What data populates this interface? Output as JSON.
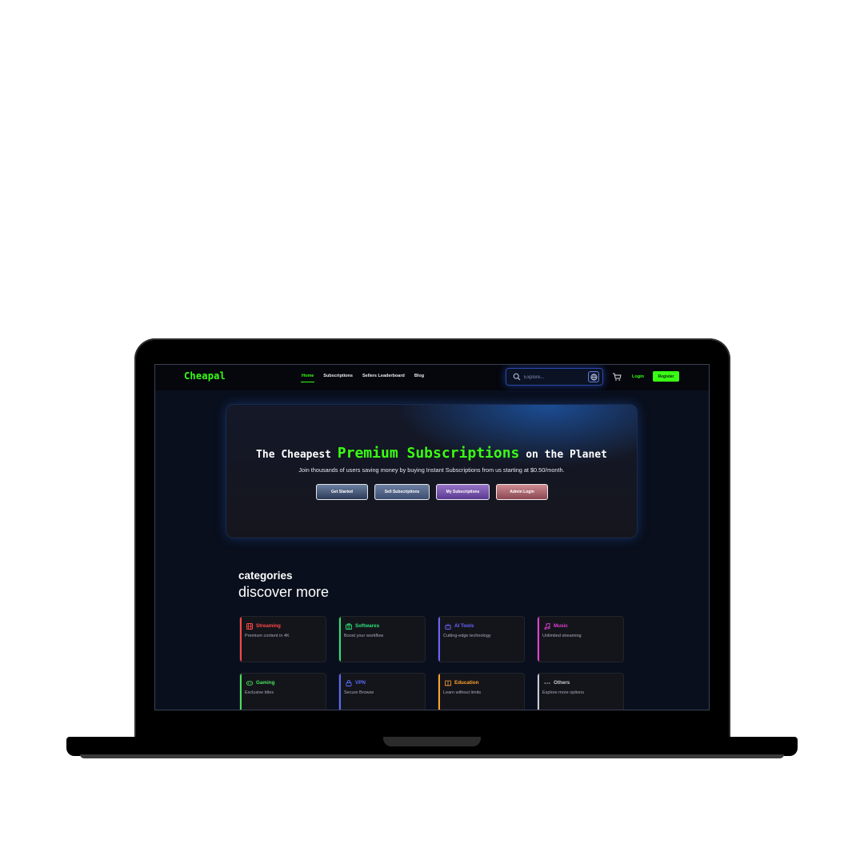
{
  "nav": {
    "logo": "Cheapal",
    "links": [
      "Home",
      "Subscriptions",
      "Sellers Leaderboard",
      "Blog"
    ],
    "active": "Home",
    "search_placeholder": "Explore...",
    "login": "Login",
    "register": "Register"
  },
  "hero": {
    "title_prefix": "The Cheapest",
    "title_highlight": "Premium Subscriptions",
    "title_suffix": "on the Planet",
    "subtitle": "Join thousands of users saving money by buying Instant Subscriptions from us starting at $0.50/month.",
    "buttons": {
      "get_started": "Get Started",
      "sell": "Sell Subscriptions",
      "my": "My Subscriptions",
      "admin": "Admin Login"
    }
  },
  "categories": {
    "heading": "categories",
    "subheading": "discover more",
    "items": [
      {
        "title": "Streaming",
        "desc": "Premium content in 4K",
        "color": "#ff4747",
        "icon": "film-icon"
      },
      {
        "title": "Softwares",
        "desc": "Boost your workflow",
        "color": "#2ee07a",
        "icon": "briefcase-icon"
      },
      {
        "title": "AI Tools",
        "desc": "Cutting-edge technology",
        "color": "#6b63ff",
        "icon": "robot-icon"
      },
      {
        "title": "Music",
        "desc": "Unlimited streaming",
        "color": "#e23fd4",
        "icon": "music-note-icon"
      },
      {
        "title": "Gaming",
        "desc": "Exclusive titles",
        "color": "#48e25a",
        "icon": "gamepad-icon"
      },
      {
        "title": "VPN",
        "desc": "Secure Browse",
        "color": "#5a6bff",
        "icon": "lock-icon"
      },
      {
        "title": "Education",
        "desc": "Learn without limits",
        "color": "#ffa12b",
        "icon": "book-icon"
      },
      {
        "title": "Others",
        "desc": "Explore more options",
        "color": "#c9ccd6",
        "icon": "ellipsis-icon"
      }
    ]
  },
  "colors": {
    "accent": "#39ff14",
    "background": "#090f1c"
  }
}
